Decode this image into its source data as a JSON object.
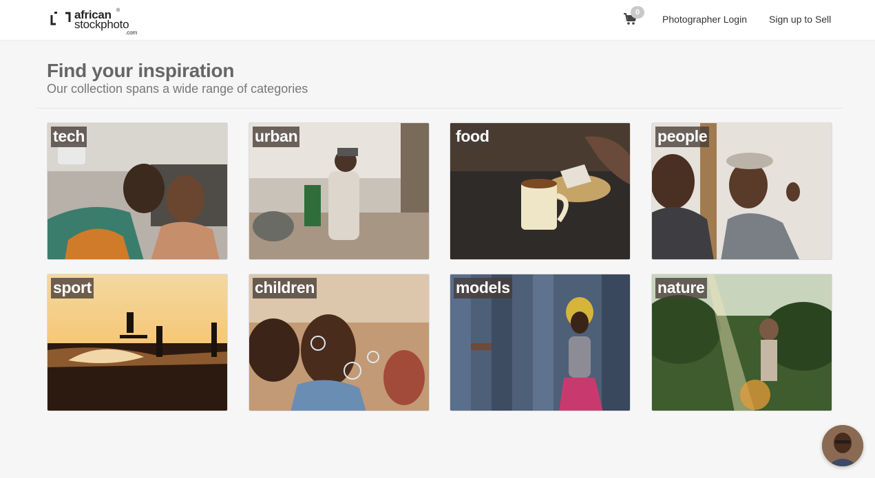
{
  "header": {
    "logo": {
      "line1": "african",
      "line2": "stockphoto",
      "suffix": ".com",
      "reg_mark": "®"
    },
    "cart_count": "0",
    "login_label": "Photographer Login",
    "signup_label": "Sign up to Sell"
  },
  "intro": {
    "title": "Find your inspiration",
    "subtitle": "Our collection spans a wide range of categories"
  },
  "categories": [
    {
      "label": "tech"
    },
    {
      "label": "urban"
    },
    {
      "label": "food"
    },
    {
      "label": "people"
    },
    {
      "label": "sport"
    },
    {
      "label": "children"
    },
    {
      "label": "models"
    },
    {
      "label": "nature"
    }
  ],
  "icons": {
    "cart": "shopping-cart-icon",
    "logo": "camera-frame-logo-icon",
    "chat": "support-agent-avatar"
  }
}
